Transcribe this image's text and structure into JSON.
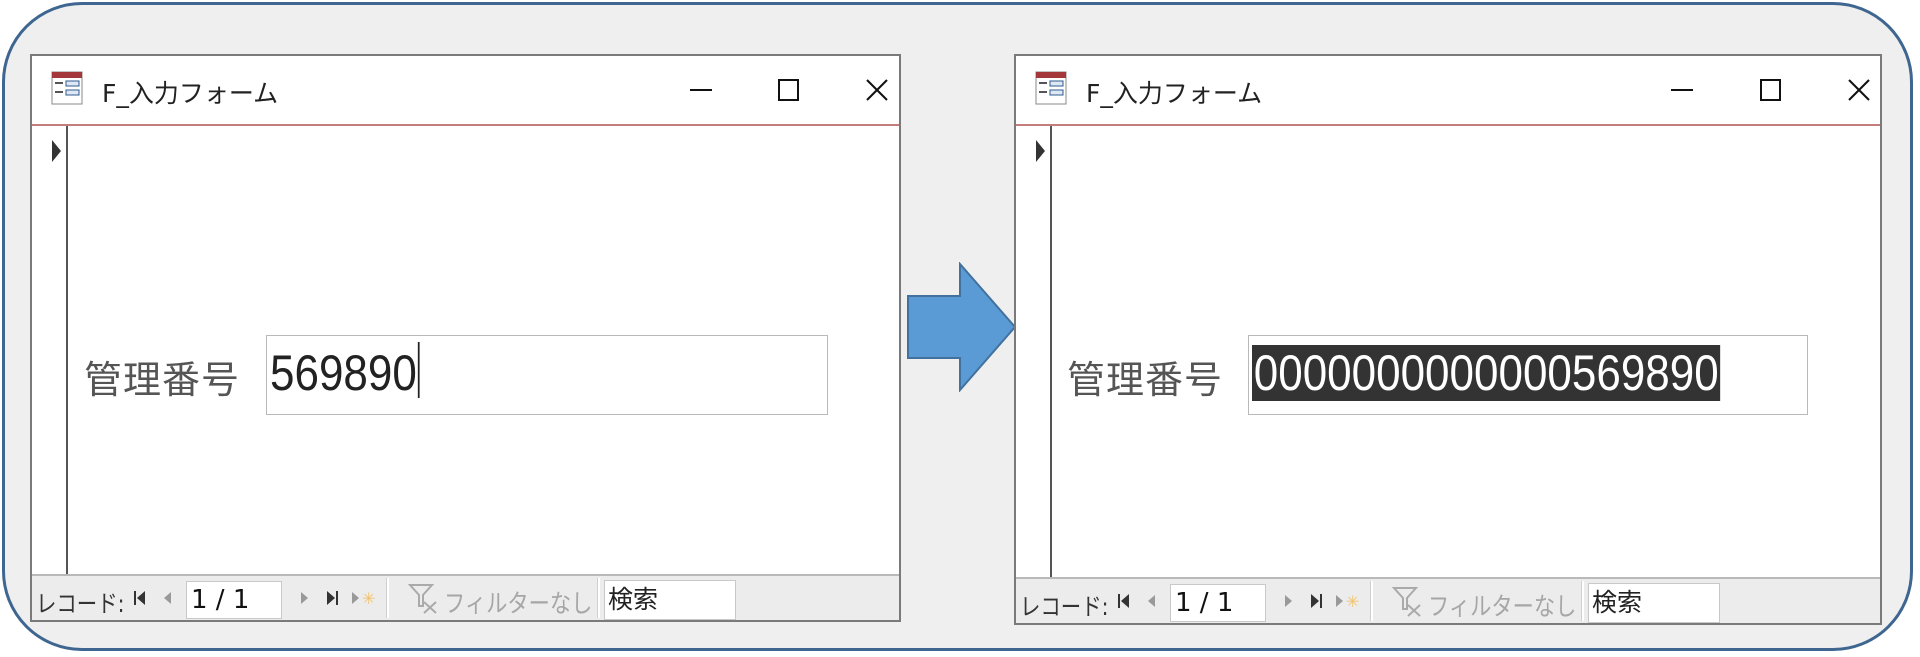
{
  "left_window": {
    "title": "F_入力フォーム",
    "field_label": "管理番号",
    "field_value": "569890",
    "nav": {
      "record_label": "レコード:",
      "current": "1 / 1",
      "filter_label": "フィルターなし",
      "search_placeholder": "検索"
    }
  },
  "right_window": {
    "title": "F_入力フォーム",
    "field_label": "管理番号",
    "field_value": "0000000000000569890",
    "nav": {
      "record_label": "レコード:",
      "current": "1 / 1",
      "filter_label": "フィルターなし",
      "search_placeholder": "検索"
    }
  },
  "colors": {
    "frame_border": "#3e6690",
    "arrow_fill": "#5b9bd5",
    "title_divider": "#c47d7d",
    "selection": "#333333"
  },
  "icons": [
    "form-icon",
    "minimize-icon",
    "maximize-icon",
    "close-icon",
    "record-selector-icon",
    "first-record-icon",
    "previous-record-icon",
    "next-record-icon",
    "last-record-icon",
    "new-record-icon",
    "filter-icon",
    "right-arrow-icon"
  ]
}
